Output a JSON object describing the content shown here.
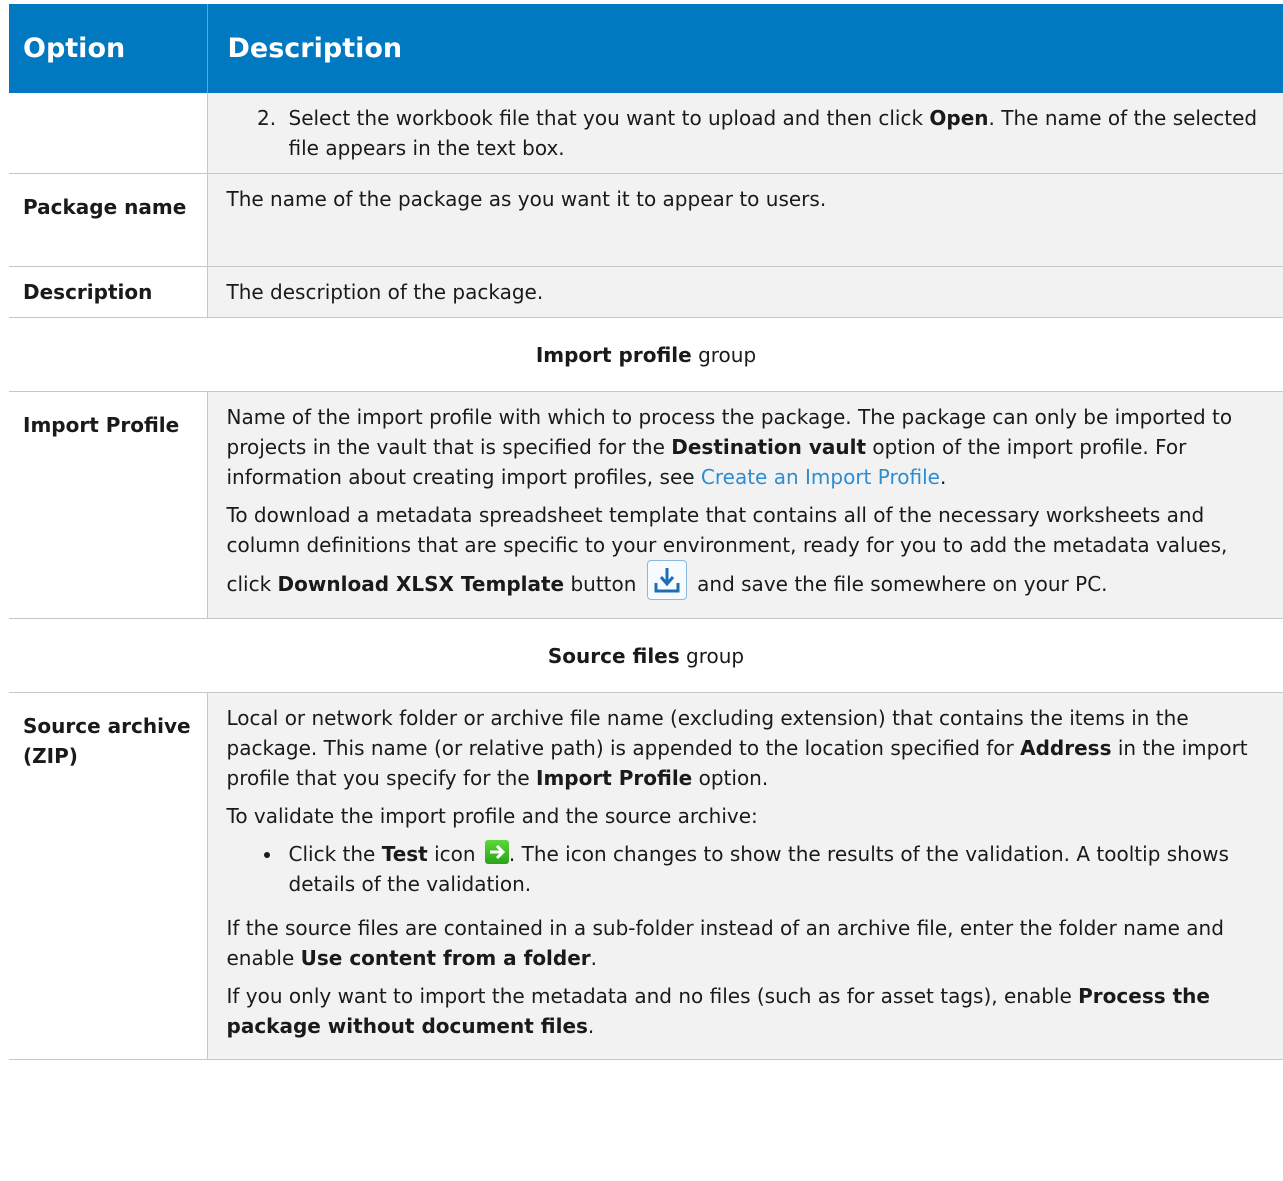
{
  "header": {
    "option": "Option",
    "description": "Description"
  },
  "rows": {
    "upload_step": {
      "number": "2",
      "before": "Select the workbook file that you want to upload and then click ",
      "bold": "Open",
      "after": ". The name of the selected file appears in the text box."
    },
    "package_name": {
      "option": "Package name",
      "description": "The name of the package as you want it to appear to users."
    },
    "description": {
      "option": "Description",
      "description": "The description of the package."
    },
    "import_profile_group": {
      "bold": "Import profile",
      "suffix": " group"
    },
    "import_profile": {
      "option": "Import Profile",
      "p1_a": "Name of the import profile with which to process the package. The package can only be imported to projects in the vault that is specified for the ",
      "p1_bold": "Destination vault",
      "p1_b": " option of the import profile. For information about creating import profiles, see ",
      "p1_link": "Create an Import Profile",
      "p1_c": ".",
      "p2_a": "To download a metadata spreadsheet template that contains all of the necessary worksheets and column definitions that are specific to your environment, ready for you to add the metadata values, click ",
      "p2_bold": "Download XLSX Template",
      "p2_b": " button ",
      "p2_c": " and save the file somewhere on your PC.",
      "download_icon": "download-icon"
    },
    "source_files_group": {
      "bold": "Source files",
      "suffix": " group"
    },
    "source_archive": {
      "option": "Source archive (ZIP)",
      "p1_a": "Local or network folder or archive file name (excluding extension) that contains the items in the package. This name (or relative path) is appended to the location specified for ",
      "p1_bold1": "Address",
      "p1_b": " in the import profile that you specify for the ",
      "p1_bold2": "Import Profile",
      "p1_c": " option.",
      "p2": "To validate the import profile and the source archive:",
      "bullet_a": "Click the ",
      "bullet_bold": "Test",
      "bullet_b": " icon ",
      "bullet_c": ". The icon changes to show the results of the validation. A tooltip shows details of the validation.",
      "p3_a": "If the source files are contained in a sub-folder instead of an archive file, enter the folder name and enable ",
      "p3_bold": "Use content from a folder",
      "p3_b": ".",
      "p4_a": "If you only want to import the metadata and no files (such as for asset tags), enable ",
      "p4_bold": "Process the package without document files",
      "p4_b": ".",
      "test_icon": "test-arrow-icon"
    }
  }
}
